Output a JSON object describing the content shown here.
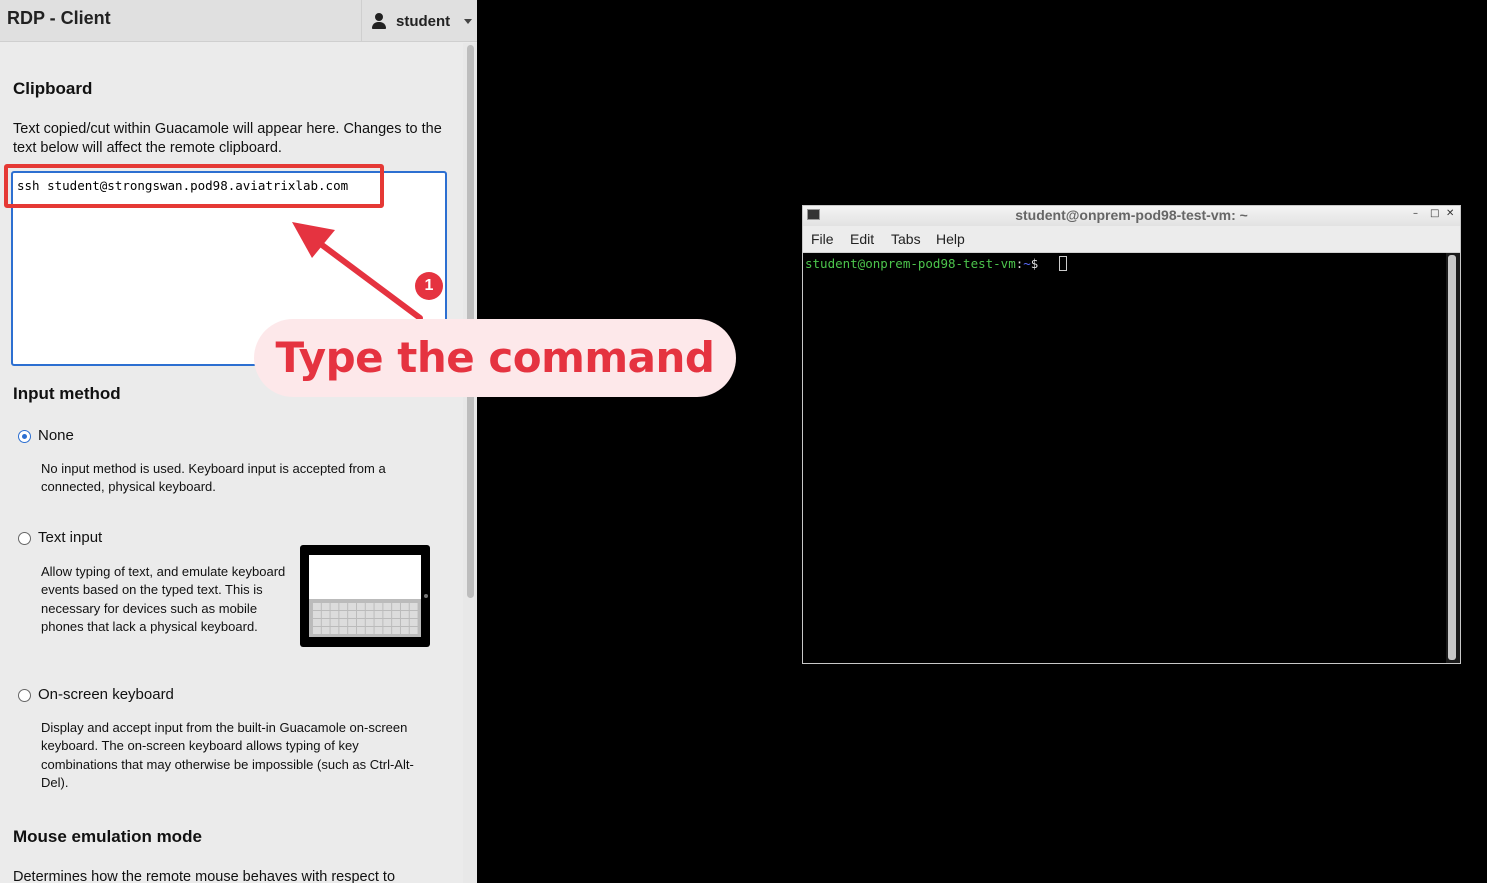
{
  "app": {
    "title": "RDP - Client",
    "user": "student"
  },
  "clipboard": {
    "heading": "Clipboard",
    "description": "Text copied/cut within Guacamole will appear here. Changes to the text below will affect the remote clipboard.",
    "value": "ssh student@strongswan.pod98.aviatrixlab.com"
  },
  "input_method": {
    "heading": "Input method",
    "options": [
      {
        "label": "None",
        "selected": true,
        "description": "No input method is used. Keyboard input is accepted from a connected, physical keyboard."
      },
      {
        "label": "Text input",
        "selected": false,
        "description": "Allow typing of text, and emulate keyboard events based on the typed text. This is necessary for devices such as mobile phones that lack a physical keyboard."
      },
      {
        "label": "On-screen keyboard",
        "selected": false,
        "description": "Display and accept input from the built-in Guacamole on-screen keyboard. The on-screen keyboard allows typing of key combinations that may otherwise be impossible (such as Ctrl-Alt-Del)."
      }
    ]
  },
  "mouse_emulation": {
    "heading": "Mouse emulation mode",
    "description": "Determines how the remote mouse behaves with respect to"
  },
  "terminal": {
    "title": "student@onprem-pod98-test-vm: ~",
    "menu": [
      "File",
      "Edit",
      "Tabs",
      "Help"
    ],
    "prompt_user": "student@onprem-pod98-test-vm",
    "prompt_sep": ":",
    "prompt_path": "~",
    "prompt_symbol": "$"
  },
  "annotation": {
    "step": "1",
    "text": "Type the command",
    "color": "#e53340"
  }
}
